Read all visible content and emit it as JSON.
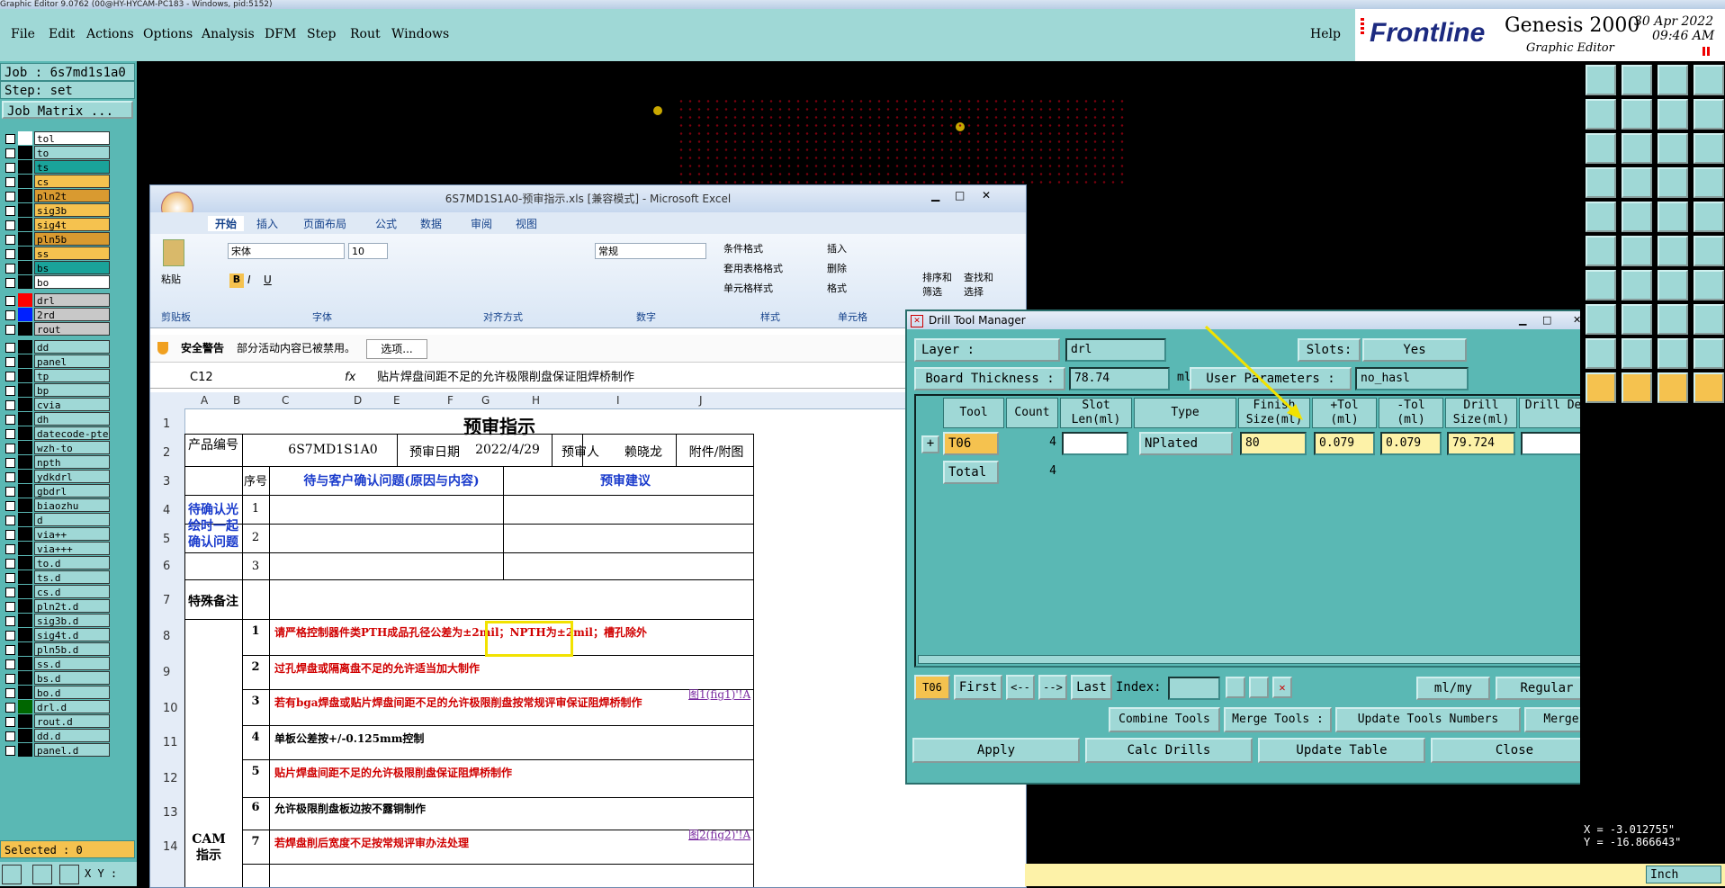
{
  "window_title": "Graphic Editor 9.0762 (00@HY-HYCAM-PC183 - Windows, pid:5152)",
  "menu": [
    "File",
    "Edit",
    "Actions",
    "Options",
    "Analysis",
    "DFM",
    "Step",
    "Rout",
    "Windows"
  ],
  "help": "Help",
  "brand": {
    "logo": "Frontline",
    "product": "Genesis 2000",
    "sub": "Graphic Editor",
    "date": "30 Apr 2022",
    "time": "09:46 AM"
  },
  "job": {
    "job": "Job : 6s7md1s1a0",
    "step": "Step: set",
    "matrix_btn": "Job Matrix ..."
  },
  "layers": [
    {
      "name": "tol",
      "color": "#ffffff",
      "bg": "#ffffff"
    },
    {
      "name": "to",
      "color": "#000000",
      "bg": "#9fd8d6"
    },
    {
      "name": "ts",
      "color": "#000000",
      "bg": "#1aa39a"
    },
    {
      "name": "cs",
      "color": "#000000",
      "bg": "#f5c24f"
    },
    {
      "name": "pln2t",
      "color": "#000000",
      "bg": "#d99a30"
    },
    {
      "name": "sig3b",
      "color": "#000000",
      "bg": "#f5c24f"
    },
    {
      "name": "sig4t",
      "color": "#000000",
      "bg": "#f5c24f"
    },
    {
      "name": "pln5b",
      "color": "#000000",
      "bg": "#d99a30"
    },
    {
      "name": "ss",
      "color": "#000000",
      "bg": "#f5c24f"
    },
    {
      "name": "bs",
      "color": "#000000",
      "bg": "#1aa39a"
    },
    {
      "name": "bo",
      "color": "#000000",
      "bg": "#ffffff"
    },
    {
      "name": "drl",
      "color": "#ff0000",
      "bg": "#c8c8c8"
    },
    {
      "name": "2rd",
      "color": "#0020ff",
      "bg": "#c8c8c8"
    },
    {
      "name": "rout",
      "color": "#000000",
      "bg": "#c8c8c8"
    },
    {
      "name": "dd",
      "color": "#000000",
      "bg": "#9fd8d6"
    },
    {
      "name": "panel",
      "color": "#000000",
      "bg": "#9fd8d6"
    },
    {
      "name": "tp",
      "color": "#000000",
      "bg": "#9fd8d6"
    },
    {
      "name": "bp",
      "color": "#000000",
      "bg": "#9fd8d6"
    },
    {
      "name": "cvia",
      "color": "#000000",
      "bg": "#9fd8d6"
    },
    {
      "name": "dh",
      "color": "#000000",
      "bg": "#9fd8d6"
    },
    {
      "name": "datecode-pte",
      "color": "#000000",
      "bg": "#9fd8d6"
    },
    {
      "name": "wzh-to",
      "color": "#000000",
      "bg": "#9fd8d6"
    },
    {
      "name": "npth",
      "color": "#000000",
      "bg": "#9fd8d6"
    },
    {
      "name": "ydkdrl",
      "color": "#000000",
      "bg": "#9fd8d6"
    },
    {
      "name": "gbdrl",
      "color": "#000000",
      "bg": "#9fd8d6"
    },
    {
      "name": "biaozhu",
      "color": "#000000",
      "bg": "#9fd8d6"
    },
    {
      "name": "d",
      "color": "#000000",
      "bg": "#9fd8d6"
    },
    {
      "name": "via++",
      "color": "#000000",
      "bg": "#9fd8d6"
    },
    {
      "name": "via+++",
      "color": "#000000",
      "bg": "#9fd8d6"
    },
    {
      "name": "to.d",
      "color": "#000000",
      "bg": "#9fd8d6"
    },
    {
      "name": "ts.d",
      "color": "#000000",
      "bg": "#9fd8d6"
    },
    {
      "name": "cs.d",
      "color": "#000000",
      "bg": "#9fd8d6"
    },
    {
      "name": "pln2t.d",
      "color": "#000000",
      "bg": "#9fd8d6"
    },
    {
      "name": "sig3b.d",
      "color": "#000000",
      "bg": "#9fd8d6"
    },
    {
      "name": "sig4t.d",
      "color": "#000000",
      "bg": "#9fd8d6"
    },
    {
      "name": "pln5b.d",
      "color": "#000000",
      "bg": "#9fd8d6"
    },
    {
      "name": "ss.d",
      "color": "#000000",
      "bg": "#9fd8d6"
    },
    {
      "name": "bs.d",
      "color": "#000000",
      "bg": "#9fd8d6"
    },
    {
      "name": "bo.d",
      "color": "#000000",
      "bg": "#9fd8d6"
    },
    {
      "name": "drl.d",
      "color": "#006600",
      "bg": "#9fd8d6"
    },
    {
      "name": "rout.d",
      "color": "#000000",
      "bg": "#9fd8d6"
    },
    {
      "name": "dd.d",
      "color": "#000000",
      "bg": "#9fd8d6"
    },
    {
      "name": "panel.d",
      "color": "#000000",
      "bg": "#9fd8d6"
    }
  ],
  "selected": "Selected : 0",
  "xy_label": "X Y :",
  "excel": {
    "title": "6S7MD1S1A0-预审指示.xls [兼容模式] - Microsoft Excel",
    "tabs": [
      "开始",
      "插入",
      "页面布局",
      "公式",
      "数据",
      "审阅",
      "视图"
    ],
    "groups": [
      "剪贴板",
      "字体",
      "对齐方式",
      "数字",
      "样式",
      "单元格"
    ],
    "font": "宋体",
    "font_size": "10",
    "number_format": "常规",
    "paste": "粘贴",
    "styles": [
      "条件格式",
      "套用表格格式",
      "单元格样式"
    ],
    "cells_btns": [
      "插入",
      "删除",
      "格式"
    ],
    "sort": "排序和筛选",
    "find": "查找和选择",
    "security_label": "安全警告",
    "security_msg": "部分活动内容已被禁用。",
    "options_btn": "选项...",
    "namebox": "C12",
    "formula": "贴片焊盘间距不足的允许极限削盘保证阻焊桥制作",
    "cols": [
      "A",
      "B",
      "C",
      "D",
      "E",
      "F",
      "G",
      "H",
      "I",
      "J"
    ],
    "rows": [
      "1",
      "2",
      "3",
      "4",
      "5",
      "6",
      "7",
      "8",
      "9",
      "10",
      "11",
      "12",
      "13",
      "14"
    ],
    "sheet_title": "预审指示",
    "product_label": "产品编号",
    "product_value": "6S7MD1S1A0",
    "date_label": "预审日期",
    "date_value": "2022/4/29",
    "reviewer_label": "预审人",
    "reviewer_value": "赖晓龙",
    "attach_label": "附件/附图",
    "seq_label": "序号",
    "issues_label": "待与客户确认问题(原因与内容)",
    "advice_label": "预审建议",
    "pending_label": "待确认光绘时一起确认问题",
    "pending_rows": [
      "1",
      "2",
      "3"
    ],
    "special_label": "特殊备注",
    "cam_label": "CAM指示",
    "cam_items": [
      {
        "n": "1",
        "text": "请严格控制器件类PTH成品孔径公差为±2mil；NPTH为±2mil；槽孔除外",
        "red": true,
        "link": ""
      },
      {
        "n": "2",
        "text": "过孔焊盘或隔离盘不足的允许适当加大制作",
        "red": true,
        "link": ""
      },
      {
        "n": "3",
        "text": "若有bga焊盘或贴片焊盘间距不足的允许极限削盘按常规评审保证阻焊桥制作",
        "red": true,
        "link": "图1(fig1)'!A"
      },
      {
        "n": "4",
        "text": "单板公差按+/-0.125mm控制",
        "red": false,
        "link": ""
      },
      {
        "n": "5",
        "text": "贴片焊盘间距不足的允许极限削盘保证阻焊桥制作",
        "red": true,
        "link": ""
      },
      {
        "n": "6",
        "text": "允许极限削盘板边按不露铜制作",
        "red": false,
        "link": ""
      },
      {
        "n": "7",
        "text": "若焊盘削后宽度不足按常规评审办法处理",
        "red": true,
        "link": "图2(fig2)'!A"
      }
    ]
  },
  "dtm": {
    "title": "Drill Tool Manager",
    "layer_label": "Layer :",
    "layer_value": "drl",
    "slots_label": "Slots:",
    "slots_value": "Yes",
    "thickness_label": "Board Thickness :",
    "thickness_value": "78.74",
    "thickness_unit": "ml",
    "user_params_label": "User Parameters :",
    "user_params_value": "no_hasl",
    "headers": [
      "Tool",
      "Count",
      "Slot Len(ml)",
      "Type",
      "Finish Size(ml)",
      "+Tol (ml)",
      "-Tol (ml)",
      "Drill Size(ml)",
      "Drill Des"
    ],
    "rows": [
      {
        "tool": "T06",
        "count": "4",
        "slot": "",
        "type": "NPlated",
        "finish": "80",
        "ptol": "0.079",
        "mtol": "0.079",
        "drill": "79.724",
        "des": ""
      }
    ],
    "total_label": "Total",
    "total_count": "4",
    "current_tool": "T06",
    "nav": [
      "First",
      "<--",
      "-->",
      "Last"
    ],
    "index_label": "Index:",
    "units": "ml/my",
    "mode": "Regular",
    "combine": "Combine Tools",
    "merge_label": "Merge Tools :",
    "update_numbers": "Update Tools Numbers",
    "merge": "Merge",
    "actions": [
      "Apply",
      "Calc Drills",
      "Update Table",
      "Close"
    ]
  },
  "coords": {
    "x": "X = -3.012755\"",
    "y": "Y = -16.866643\""
  },
  "unit": "Inch"
}
